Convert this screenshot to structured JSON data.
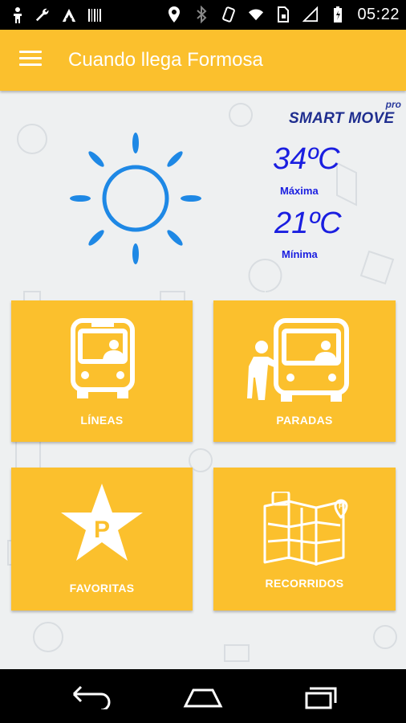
{
  "status_bar": {
    "time": "05:22",
    "left_icons": [
      "accessibility-icon",
      "wrench-icon",
      "android-debug-icon",
      "barcode-icon"
    ],
    "right_icons": [
      "location-icon",
      "bluetooth-icon",
      "rotate-icon",
      "wifi-icon",
      "sim-icon",
      "signal-icon",
      "battery-icon"
    ]
  },
  "app_bar": {
    "title": "Cuando llega Formosa",
    "menu_icon": "hamburger-menu-icon"
  },
  "logo": {
    "text": "SMART MOVE",
    "badge": "pro"
  },
  "weather": {
    "icon": "sun-icon",
    "max_temp": "34ºC",
    "max_label": "Máxima",
    "min_temp": "21ºC",
    "min_label": "Mínima",
    "color": "#1a1ee0"
  },
  "tiles": [
    {
      "label": "LÍNEAS",
      "icon": "bus-icon"
    },
    {
      "label": "PARADAS",
      "icon": "bus-stop-icon"
    },
    {
      "label": "FAVORITAS",
      "icon": "star-parking-icon"
    },
    {
      "label": "RECORRIDOS",
      "icon": "route-map-icon"
    }
  ],
  "nav_bar": {
    "back_icon": "back-icon",
    "home_icon": "home-icon",
    "recents_icon": "recents-icon"
  },
  "colors": {
    "accent": "#FBC02D",
    "background": "#eef0f1"
  }
}
